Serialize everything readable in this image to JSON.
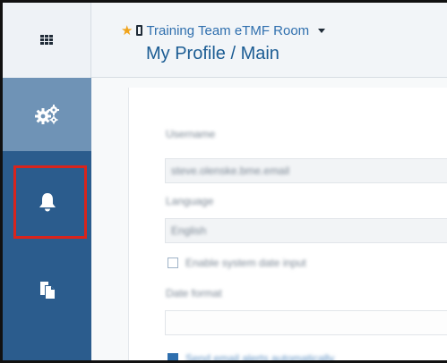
{
  "header": {
    "room_name": "Training Team eTMF Room",
    "page_title": "My Profile / Main"
  },
  "sidebar": {
    "items": [
      {
        "icon": "gears-icon",
        "active": true
      },
      {
        "icon": "bell-icon",
        "active": false,
        "highlighted": true
      },
      {
        "icon": "documents-icon",
        "active": false
      }
    ]
  },
  "form": {
    "username_label": "Username",
    "username_value": "steve.olenske.bme.email",
    "language_label": "Language",
    "language_value": "English",
    "checkbox_label": "Enable system date input",
    "date_format_label": "Date format",
    "date_format_value": "",
    "bottom_option": "Send email alerts automatically"
  },
  "colors": {
    "sidebar_bg": "#2b5c8d",
    "sidebar_active": "#6f93b6",
    "title_blue": "#1b5c93",
    "highlight_red": "#d9241c",
    "star": "#f0a31b"
  }
}
